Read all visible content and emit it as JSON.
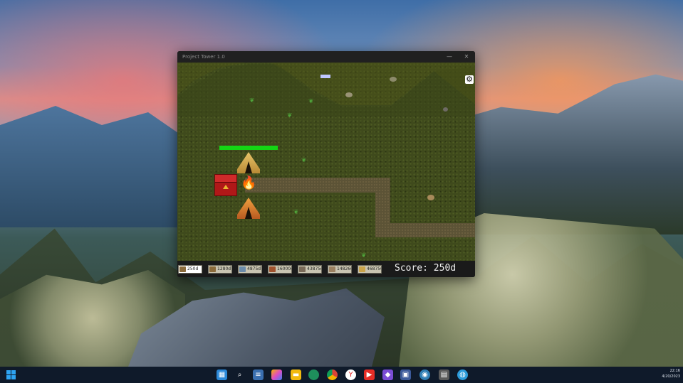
{
  "window": {
    "title": "Project Tower 1.0",
    "minimize_glyph": "—",
    "close_glyph": "✕"
  },
  "game": {
    "settings_icon": "gear-icon",
    "colors": {
      "grass": "#3f4a1c",
      "path": "#5c5336",
      "health": "#14d614",
      "chest": "#b01818"
    }
  },
  "toolbar": {
    "items": [
      {
        "label": "250d",
        "icon": "soldier-icon"
      },
      {
        "label": "1280d",
        "icon": "archer-icon"
      },
      {
        "label": "4875d",
        "icon": "wizard-icon"
      },
      {
        "label": "16000d",
        "icon": "knight-icon"
      },
      {
        "label": "43875d",
        "icon": "tower-icon"
      },
      {
        "label": "148266d",
        "icon": "catapult-icon"
      },
      {
        "label": "468750",
        "icon": "dragon-icon"
      }
    ],
    "score_label": "Score:",
    "score_value": "250d"
  },
  "taskbar": {
    "clock_time": "22:16",
    "clock_date": "4/20/2023",
    "apps": [
      "start-icon",
      "widgets-icon",
      "search-icon",
      "notepad-icon",
      "copilot-icon",
      "edge-icon",
      "files-icon",
      "chrome-icon",
      "yandex-icon",
      "youtube-icon",
      "visual-studio-icon",
      "save-icon",
      "globe-icon",
      "game-icon",
      "browser-icon"
    ]
  }
}
